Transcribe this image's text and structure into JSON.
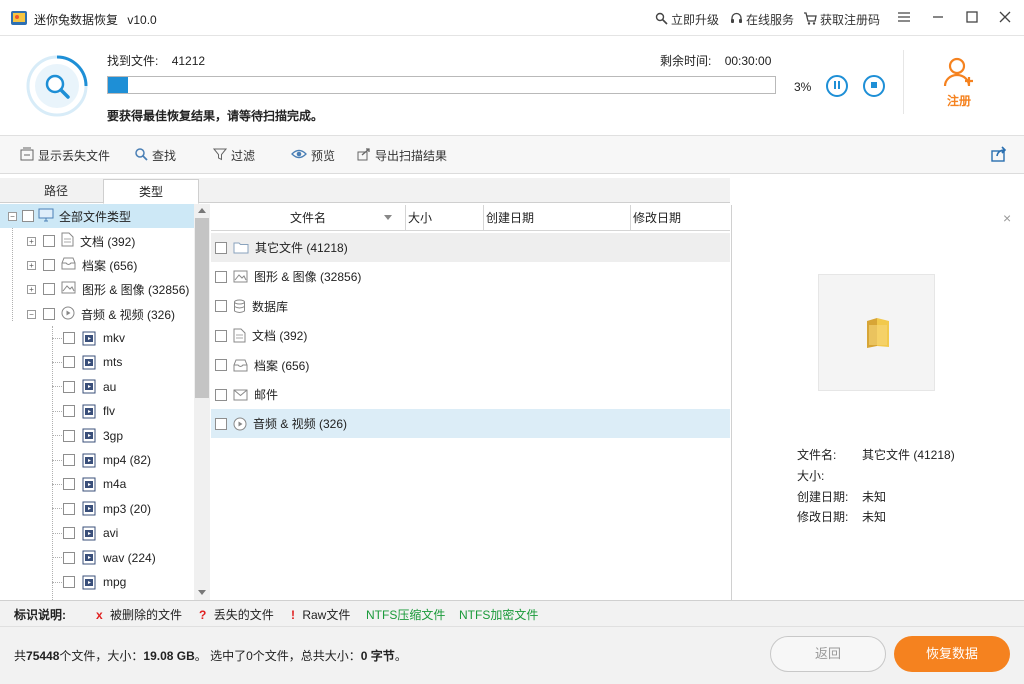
{
  "window": {
    "title": "迷你兔数据恢复",
    "version": "v10.0",
    "links": [
      "立即升级",
      "在线服务",
      "获取注册码"
    ]
  },
  "scan": {
    "found_label": "找到文件:",
    "found_count": "41212",
    "remaining_label": "剩余时间:",
    "remaining_time": "00:30:00",
    "progress_percent": 3,
    "progress_text": "3%",
    "hint": "要获得最佳恢复结果，请等待扫描完成。",
    "register_label": "注册"
  },
  "toolbar": {
    "show_lost": "显示丢失文件",
    "find": "查找",
    "filter": "过滤",
    "preview": "预览",
    "export": "导出扫描结果"
  },
  "tabs": {
    "path": "路径",
    "type": "类型",
    "active": "type"
  },
  "tree": {
    "root": "全部文件类型",
    "categories": [
      {
        "label": "文档 (392)",
        "icon": "document-icon"
      },
      {
        "label": "档案 (656)",
        "icon": "archive-icon"
      },
      {
        "label": "图形 & 图像 (32856)",
        "icon": "image-icon"
      },
      {
        "label": "音频 & 视频 (326)",
        "icon": "play-icon"
      }
    ],
    "media_items": [
      "mkv",
      "mts",
      "au",
      "flv",
      "3gp",
      "mp4 (82)",
      "m4a",
      "mp3 (20)",
      "avi",
      "wav (224)",
      "mpg"
    ]
  },
  "list": {
    "columns": [
      "文件名",
      "大小",
      "创建日期",
      "修改日期"
    ],
    "rows": [
      {
        "name": "其它文件 (41218)",
        "icon": "folder-icon"
      },
      {
        "name": "图形 & 图像 (32856)",
        "icon": "image-icon"
      },
      {
        "name": "数据库",
        "icon": "database-icon"
      },
      {
        "name": "文档 (392)",
        "icon": "document-icon"
      },
      {
        "name": "档案 (656)",
        "icon": "archive-icon"
      },
      {
        "name": "邮件",
        "icon": "mail-icon"
      },
      {
        "name": "音频 & 视频 (326)",
        "icon": "play-icon"
      }
    ]
  },
  "preview": {
    "filename_label": "文件名:",
    "filename": "其它文件 (41218)",
    "size_label": "大小:",
    "created_label": "创建日期:",
    "created": "未知",
    "modified_label": "修改日期:",
    "modified": "未知"
  },
  "legend": {
    "title": "标识说明:",
    "items": [
      {
        "mark": "x",
        "text": "被删除的文件",
        "color": "#e02020"
      },
      {
        "mark": "?",
        "text": "丢失的文件",
        "color": "#e02020"
      },
      {
        "mark": "!",
        "text": "Raw文件",
        "color": "#e02020"
      },
      {
        "mark": "",
        "text": "NTFS压缩文件",
        "color": "#1a9a3a"
      },
      {
        "mark": "",
        "text": "NTFS加密文件",
        "color": "#1a9a3a"
      }
    ]
  },
  "status": {
    "prefix": "共",
    "total_files": "75448",
    "files_unit": "个文件，大小：",
    "total_size": "19.08 GB",
    "selected_text": "。 选中了0个文件，总共大小：",
    "selected_size": "0 字节",
    "suffix": "。",
    "back_label": "返回",
    "recover_label": "恢复数据"
  },
  "colors": {
    "accent": "#1e8fd6",
    "orange": "#f5821f",
    "selected_row": "#dcedf7"
  }
}
